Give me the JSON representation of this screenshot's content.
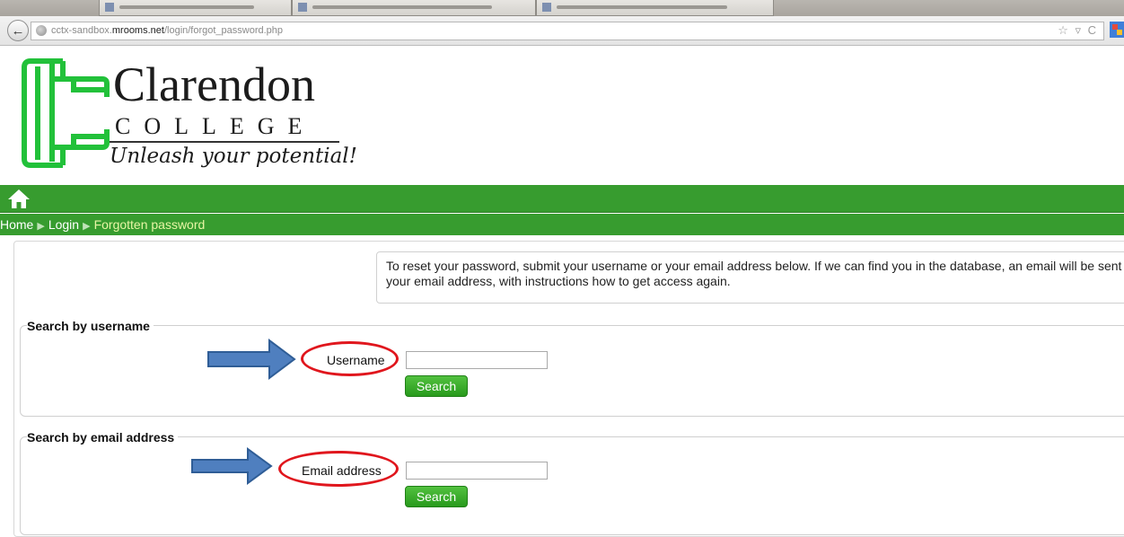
{
  "browser": {
    "url_prefix": "cctx-sandbox.",
    "url_host": "mrooms.net",
    "url_path": "/login/forgot_password.php",
    "url_icons": "☆ ▿ C"
  },
  "logo": {
    "name": "Clarendon",
    "subtitle": "COLLEGE",
    "tagline": "Unleash your potential!",
    "color": "#22c13a"
  },
  "nav": {
    "bg_color": "#379c2f",
    "breadcrumb": {
      "home": "Home",
      "login": "Login",
      "current": "Forgotten password",
      "separator": "▶"
    }
  },
  "notice": "To reset your password, submit your username or your email address below. If we can find you in the database, an email will be sent to your email address, with instructions how to get access again.",
  "search_username": {
    "legend": "Search by username",
    "label": "Username",
    "value": "",
    "button": "Search"
  },
  "search_email": {
    "legend": "Search by email address",
    "label": "Email address",
    "value": "",
    "button": "Search"
  },
  "annotation": {
    "arrow_color": "#4f7fbf",
    "ellipse_color": "#e0161d"
  }
}
